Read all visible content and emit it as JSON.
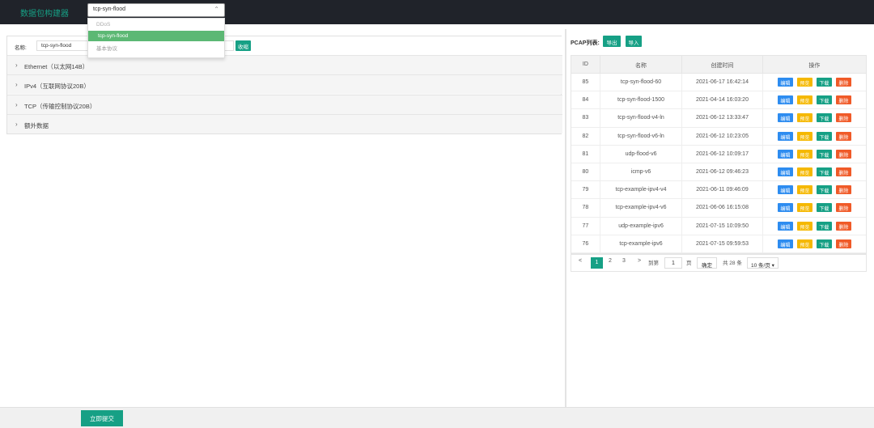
{
  "app": {
    "title": "数据包构建器"
  },
  "top_select": {
    "value": "tcp-syn-flood"
  },
  "dropdown": {
    "group1": "DDoS",
    "option1": "tcp-syn-flood",
    "group2": "基本协议"
  },
  "left": {
    "name_label": "名称:",
    "name_value": "tcp-syn-flood",
    "collapse_label": "收缩",
    "sections": [
      "Ethernet（以太网14B）",
      "IPv4（互联网协议20B）",
      "TCP（传输控制协议20B）",
      "额外数据"
    ]
  },
  "right": {
    "pcap_label": "PCAP列表:",
    "export_label": "导出",
    "import_label": "导入",
    "table": {
      "headers": [
        "ID",
        "名称",
        "创建时间",
        "操作"
      ],
      "rows": [
        {
          "id": "85",
          "name": "tcp-syn-flood-60",
          "time": "2021-06-17 16:42:14"
        },
        {
          "id": "84",
          "name": "tcp-syn-flood-1500",
          "time": "2021-04-14 16:03:20"
        },
        {
          "id": "83",
          "name": "tcp-syn-flood-v4-ln",
          "time": "2021-06-12 13:33:47"
        },
        {
          "id": "82",
          "name": "tcp-syn-flood-v6-ln",
          "time": "2021-06-12 10:23:05"
        },
        {
          "id": "81",
          "name": "udp-flood-v6",
          "time": "2021-06-12 10:09:17"
        },
        {
          "id": "80",
          "name": "icmp-v6",
          "time": "2021-06-12 09:46:23"
        },
        {
          "id": "79",
          "name": "tcp-example-ipv4-v4",
          "time": "2021-06-11 09:46:09"
        },
        {
          "id": "78",
          "name": "tcp-example-ipv4-v6",
          "time": "2021-06-06 16:15:08"
        },
        {
          "id": "77",
          "name": "udp-example-ipv6",
          "time": "2021-07-15 10:09:50"
        },
        {
          "id": "76",
          "name": "tcp-example-ipv6",
          "time": "2021-07-15 09:59:53"
        }
      ],
      "ops": {
        "edit": "编辑",
        "preview": "预览",
        "download": "下载",
        "delete": "删除"
      }
    },
    "pager": {
      "prev": "<",
      "pages": [
        "1",
        "2",
        "3"
      ],
      "current": "1",
      "next": ">",
      "goto_label": "到第",
      "goto_value": "1",
      "page_unit": "页",
      "confirm": "确定",
      "total": "共 28 条",
      "per_page": "10 条/页"
    }
  },
  "footer": {
    "submit_label": "立即提交"
  }
}
